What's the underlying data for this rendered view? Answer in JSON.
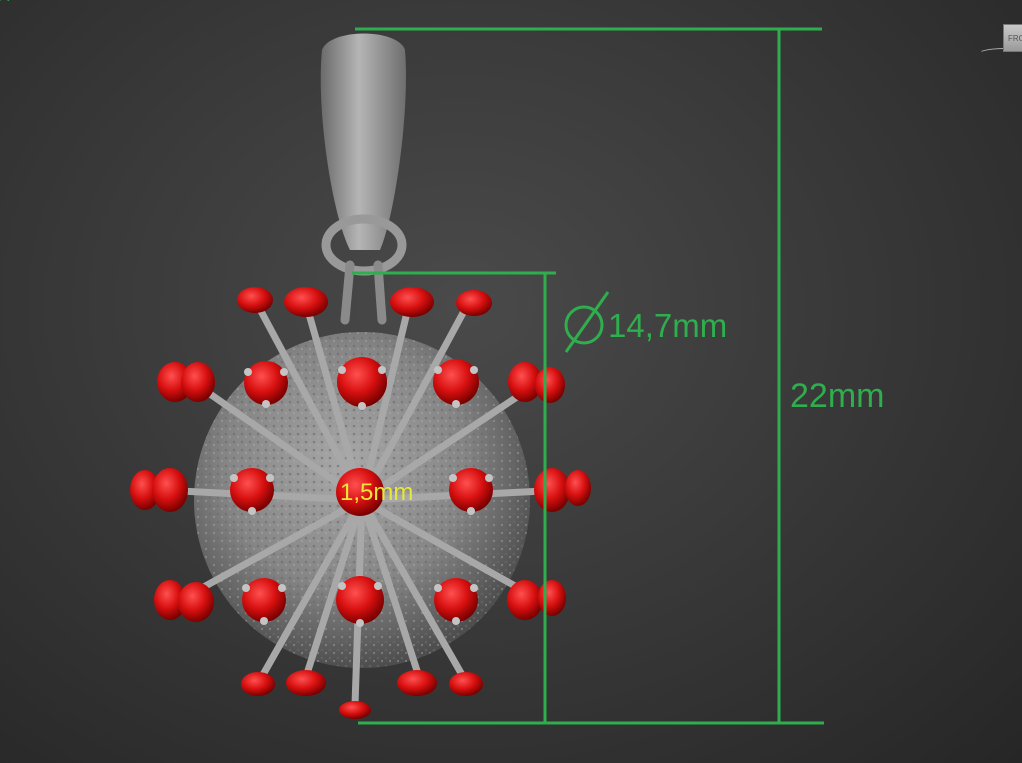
{
  "viewport": {
    "background": "#333333"
  },
  "dimensions": {
    "diameter_label": "14,7mm",
    "height_label": "22mm",
    "gem_label": "1,5mm",
    "line_color": "#2fae4e",
    "gem_label_color": "#e8e63a"
  },
  "model": {
    "body_color": "#8c8c8c",
    "gem_color": "#e01010"
  },
  "viewcube": {
    "label": "FRO",
    "icon": "viewcube-icon"
  }
}
